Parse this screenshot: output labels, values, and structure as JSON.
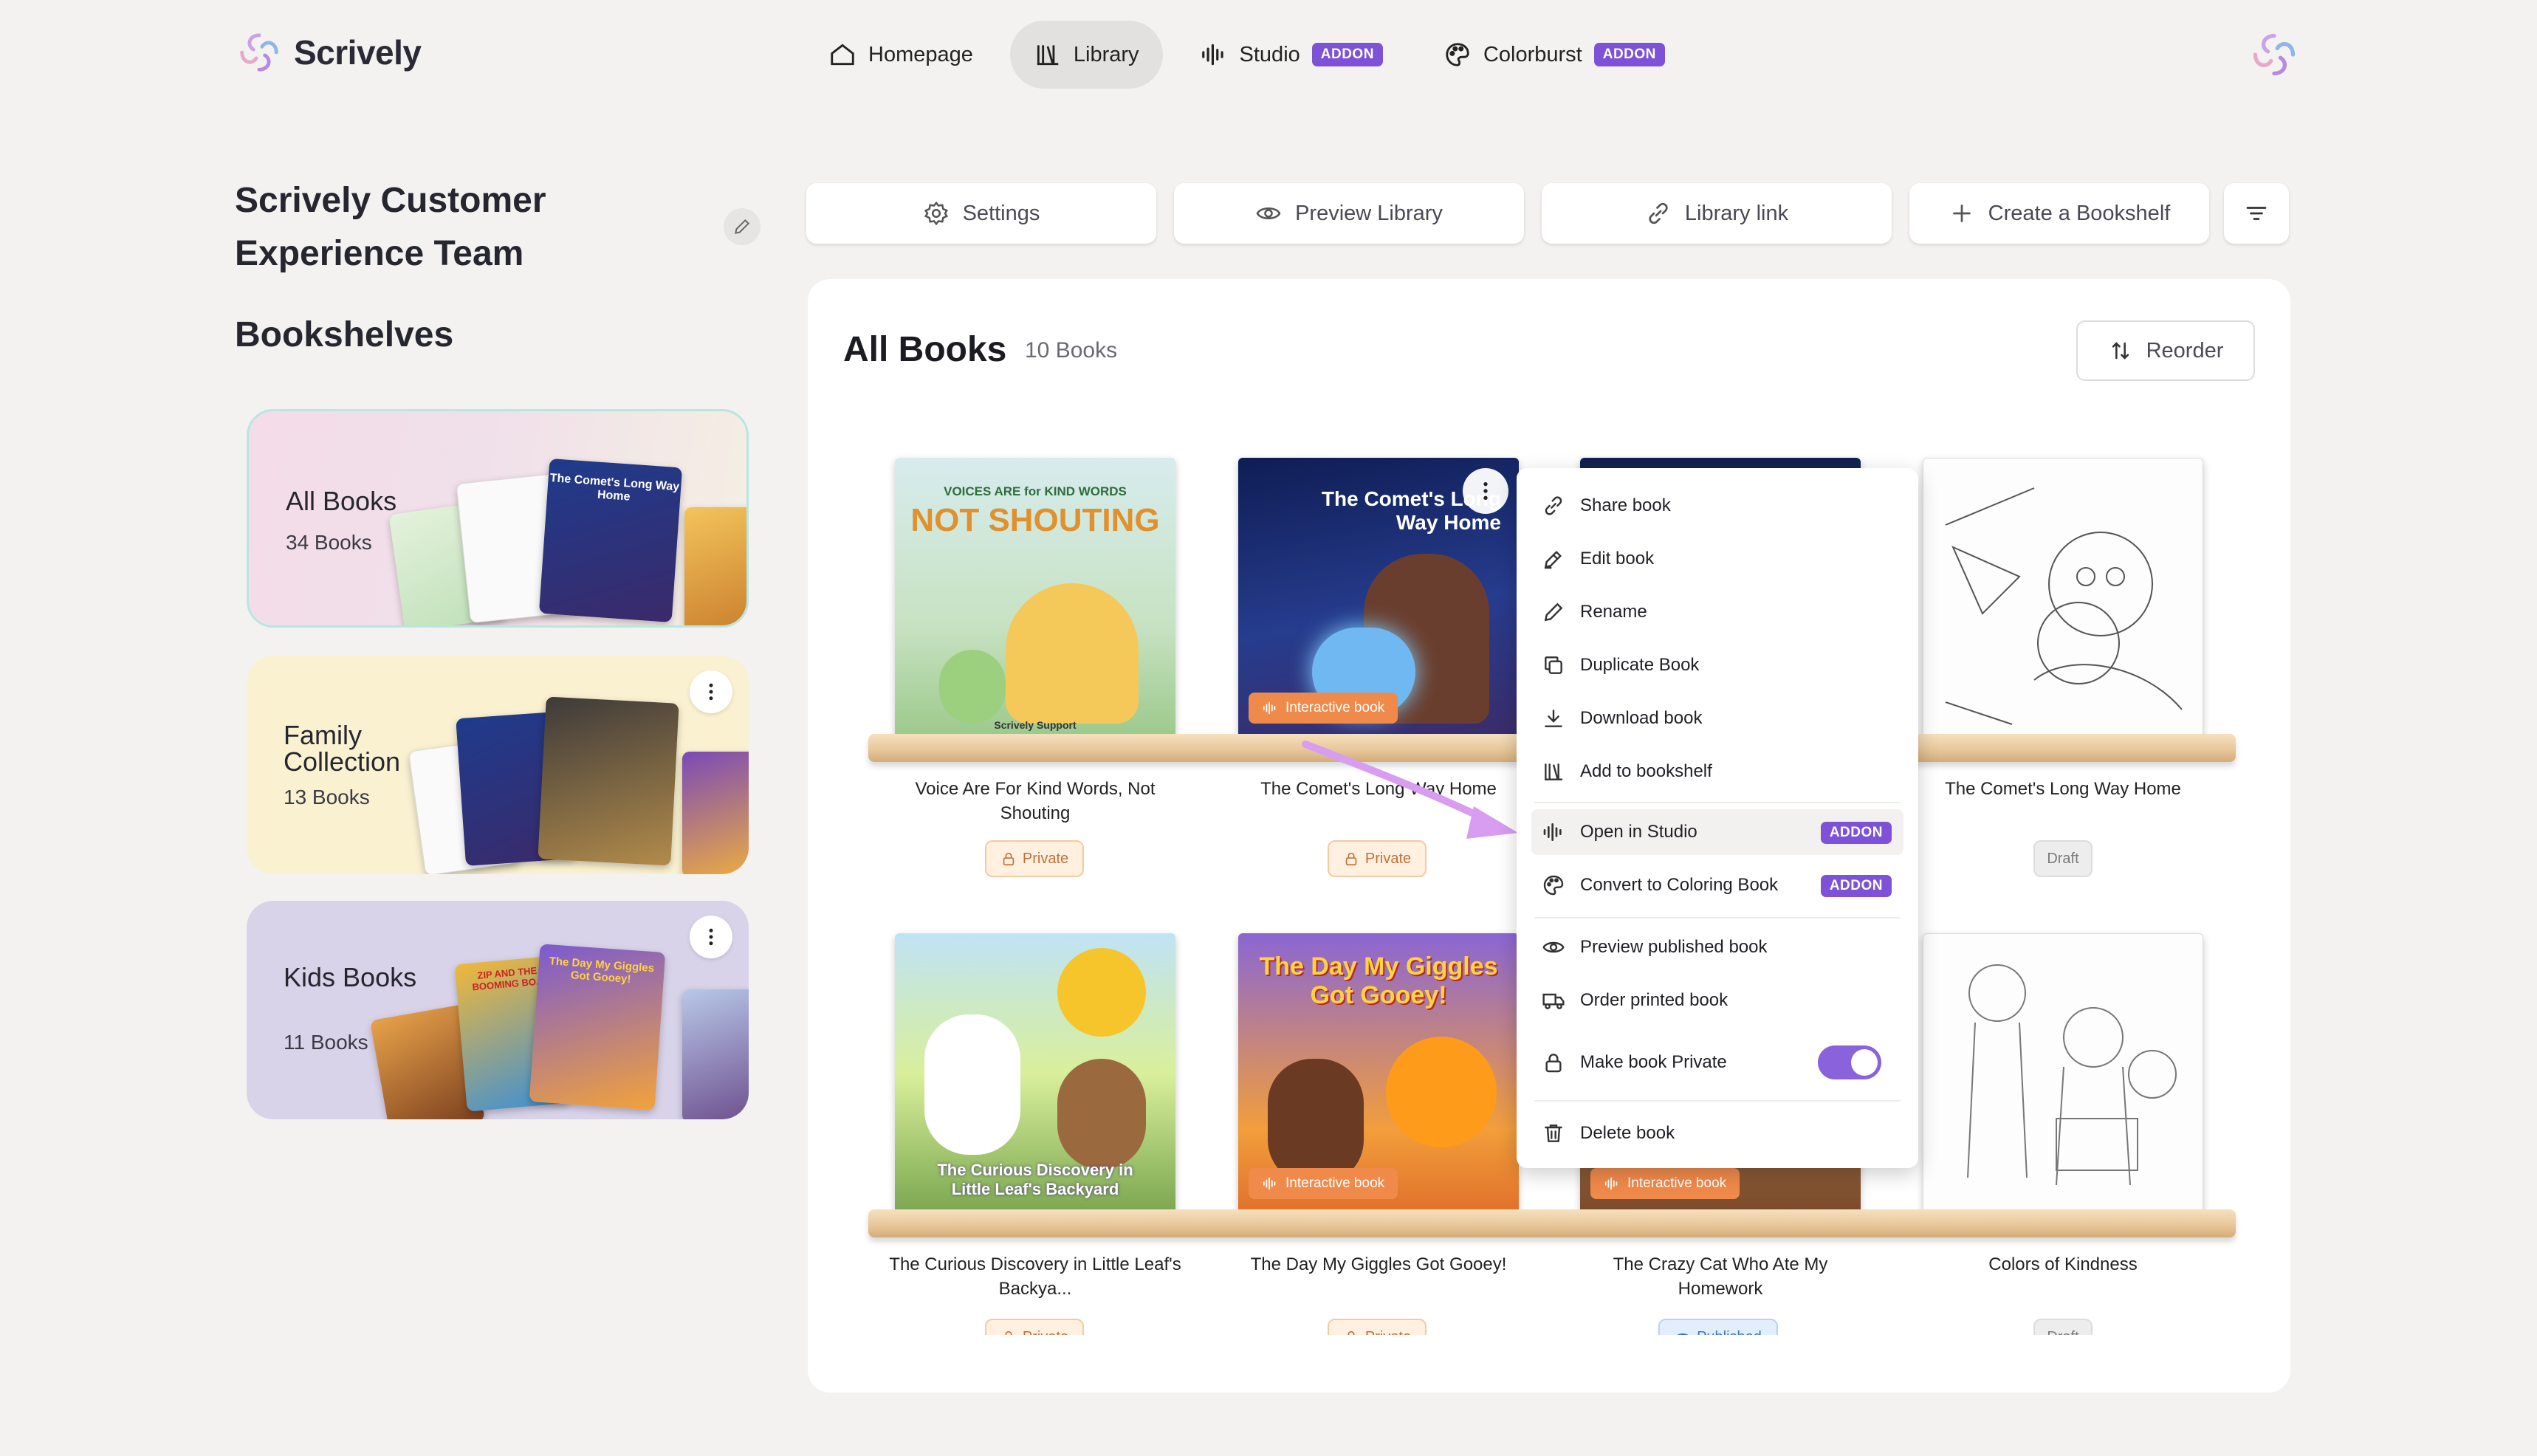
{
  "brand": {
    "name": "Scrively"
  },
  "nav": {
    "items": [
      {
        "label": "Homepage",
        "icon": "home-icon"
      },
      {
        "label": "Library",
        "icon": "library-icon"
      },
      {
        "label": "Studio",
        "icon": "waveform-icon",
        "badge": "ADDON"
      },
      {
        "label": "Colorburst",
        "icon": "palette-icon",
        "badge": "ADDON"
      }
    ]
  },
  "team": {
    "title": "Scrively Customer Experience Team"
  },
  "sidebar": {
    "heading": "Bookshelves",
    "shelves": [
      {
        "name": "All Books",
        "count": "34 Books"
      },
      {
        "name": "Family Collection",
        "count": "13 Books"
      },
      {
        "name": "Kids Books",
        "count": "11 Books"
      }
    ]
  },
  "actions": {
    "settings": "Settings",
    "preview": "Preview Library",
    "link": "Library link",
    "create": "Create a Bookshelf"
  },
  "panel": {
    "title": "All Books",
    "count": "10 Books",
    "reorder": "Reorder"
  },
  "books": [
    {
      "title": "Voice Are For Kind Words, Not Shouting",
      "status": "Private",
      "cover_text_top": "VOICES ARE for KIND WORDS",
      "cover_text_main": "NOT SHOUTING",
      "cover_author": "Scrively Support"
    },
    {
      "title": "The Comet's Long Way Home",
      "status": "Private",
      "tag": "Interactive book",
      "cover_text_main": "The Comet's Long Way Home"
    },
    {
      "title": "",
      "status": ""
    },
    {
      "title": "The Comet's Long Way Home",
      "status": "Draft"
    },
    {
      "title": "The Curious Discovery in Little Leaf's Backya...",
      "status": "Private",
      "cover_text_main": "The Curious Discovery in Little Leaf's Backyard"
    },
    {
      "title": "The Day My Giggles Got Gooey!",
      "status": "Private",
      "tag": "Interactive book",
      "cover_text_main": "The Day My Giggles Got Gooey!"
    },
    {
      "title": "The Crazy Cat Who Ate My Homework",
      "status": "Published",
      "tag": "Interactive book"
    },
    {
      "title": "Colors of Kindness",
      "status": "Draft"
    }
  ],
  "mini_covers": {
    "all_books": "The Comet's Long Way Home",
    "kids_books": "The Day My Giggles Got Gooey!",
    "zip": "ZIP AND THE BOOMING BO..."
  },
  "menu": {
    "items": [
      {
        "label": "Share book",
        "icon": "link-icon"
      },
      {
        "label": "Edit book",
        "icon": "edit-icon"
      },
      {
        "label": "Rename",
        "icon": "pencil-icon"
      },
      {
        "label": "Duplicate Book",
        "icon": "copy-icon"
      },
      {
        "label": "Download book",
        "icon": "download-icon"
      },
      {
        "label": "Add to bookshelf",
        "icon": "library-icon"
      },
      {
        "label": "Open in Studio",
        "icon": "waveform-icon",
        "badge": "ADDON"
      },
      {
        "label": "Convert to Coloring Book",
        "icon": "palette-icon",
        "badge": "ADDON"
      },
      {
        "label": "Preview published book",
        "icon": "eye-icon"
      },
      {
        "label": "Order printed book",
        "icon": "truck-icon"
      },
      {
        "label": "Make book Private",
        "icon": "lock-icon",
        "toggle": true
      },
      {
        "label": "Delete book",
        "icon": "trash-icon"
      }
    ]
  },
  "colors": {
    "accent": "#7e52d6",
    "orange": "#f08a4b",
    "plank": "#e8c89b"
  }
}
